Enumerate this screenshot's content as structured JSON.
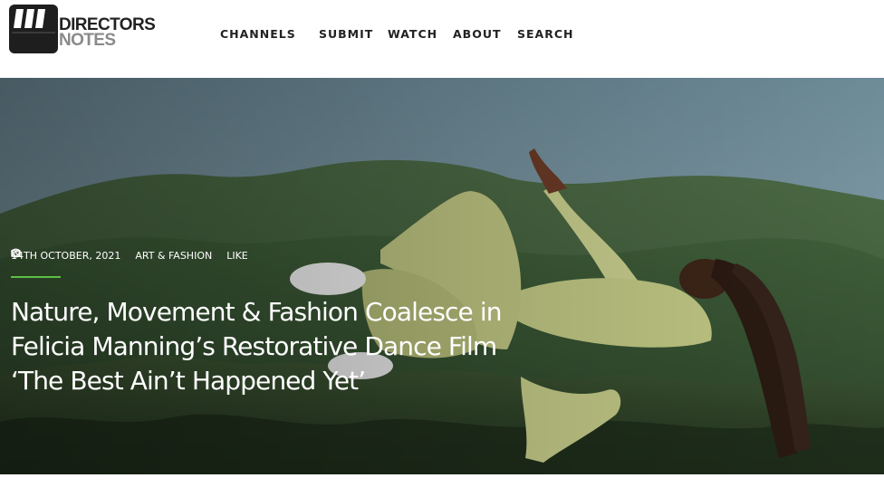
{
  "logo": {
    "line1": "DIRECTORS",
    "line2": "NOTES",
    "icon": "clapperboard-icon"
  },
  "nav": {
    "items": [
      {
        "label": "CHANNELS"
      },
      {
        "label": "SUBMIT"
      },
      {
        "label": "WATCH"
      },
      {
        "label": "ABOUT"
      },
      {
        "label": "SEARCH"
      }
    ]
  },
  "article": {
    "date": "14TH OCTOBER, 2021",
    "category": "ART & FASHION",
    "like_label": "LIKE",
    "title": "Nature, Movement & Fashion Coalesce in Felicia Manning’s Restorative Dance Film ‘The Best Ain’t Happened Yet’",
    "icons": {
      "date": "clock-icon",
      "category": "folder-icon",
      "like": "heart-icon"
    }
  },
  "colors": {
    "accent": "#5bbf45",
    "text_dark": "#222222",
    "logo_grey": "#8a8a8a"
  }
}
